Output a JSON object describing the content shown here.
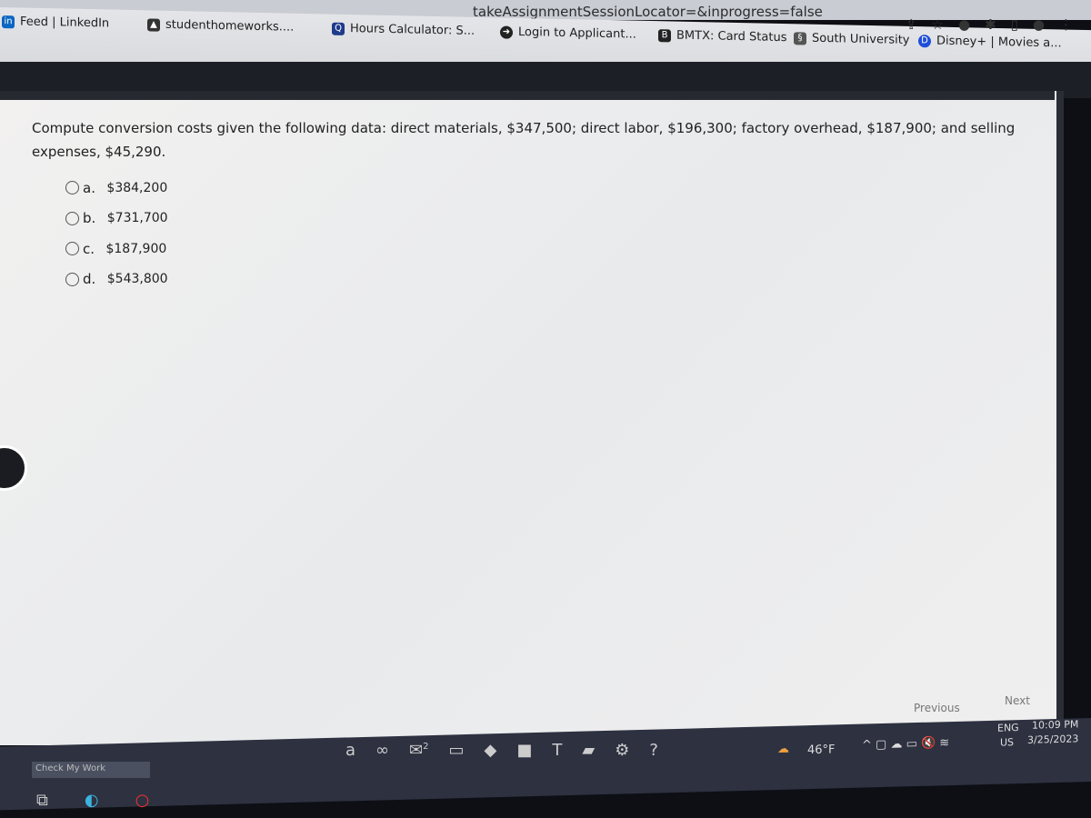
{
  "browser": {
    "url": "takeAssignmentSessionLocator=&inprogress=false",
    "bookmarks": [
      {
        "label": "Feed | LinkedIn",
        "icon": "linkedin-icon",
        "color": "#0a66c2"
      },
      {
        "label": "studenthomeworks....",
        "icon": "graduation-cap-icon",
        "color": "#333333"
      },
      {
        "label": "Hours Calculator: S...",
        "icon": "calculator-icon",
        "color": "#1e3a8a"
      },
      {
        "label": "Login to Applicant...",
        "icon": "globe-icon",
        "color": "#222222"
      },
      {
        "label": "BMTX: Card Status",
        "icon": "b-icon",
        "color": "#222222"
      },
      {
        "label": "South University",
        "icon": "south-university-icon",
        "color": "#333333"
      },
      {
        "label": "Disney+ | Movies a...",
        "icon": "disney-icon",
        "color": "#1e4fd8"
      }
    ]
  },
  "question": {
    "text": "Compute conversion costs given the following data: direct materials, $347,500; direct labor, $196,300; factory overhead, $187,900; and selling expenses, $45,290.",
    "options": [
      {
        "letter": "a.",
        "value": "$384,200"
      },
      {
        "letter": "b.",
        "value": "$731,700"
      },
      {
        "letter": "c.",
        "value": "$187,900"
      },
      {
        "letter": "d.",
        "value": "$543,800"
      }
    ]
  },
  "nav": {
    "previous": "Previous",
    "next": "Next",
    "check": "Check My Work"
  },
  "taskbar": {
    "weather": "46°F",
    "lang1": "ENG",
    "lang2": "US",
    "time": "10:09 PM",
    "date": "3/25/2023",
    "app_a": "a",
    "badge": "2"
  }
}
